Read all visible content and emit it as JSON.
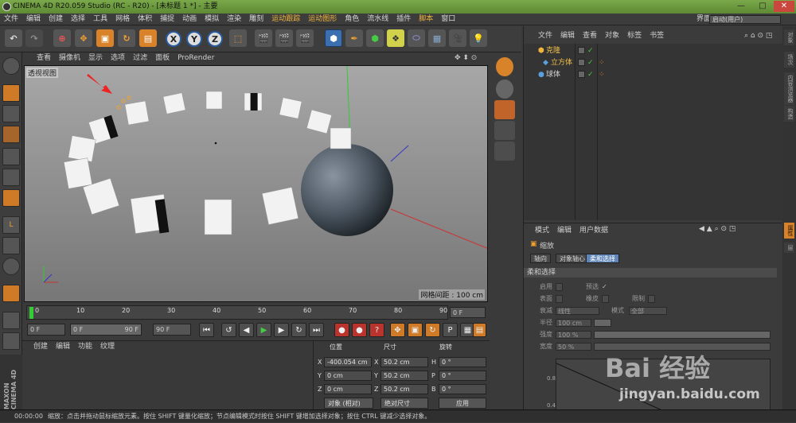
{
  "title": "CINEMA 4D R20.059 Studio (RC - R20) - [未标题 1 *] - 主要",
  "menu": [
    "文件",
    "编辑",
    "创建",
    "选择",
    "工具",
    "网格",
    "体积",
    "捕捉",
    "动画",
    "模拟",
    "渲染",
    "雕刻",
    "运动跟踪",
    "运动图形",
    "角色",
    "流水线",
    "插件",
    "脚本",
    "窗口"
  ],
  "interface": {
    "label": "界面:",
    "value": "启动(用户)"
  },
  "toolbar_axes": [
    "X",
    "Y",
    "Z"
  ],
  "viewport": {
    "menu": [
      "查看",
      "摄像机",
      "显示",
      "选项",
      "过滤",
      "面板",
      "ProRender"
    ],
    "label": "透视视图",
    "grid": "网格间距 : 100 cm"
  },
  "object_manager": {
    "menu": [
      "文件",
      "编辑",
      "查看",
      "对象",
      "标签",
      "书签"
    ],
    "objects": [
      {
        "name": "克隆",
        "indent": 0
      },
      {
        "name": "立方体",
        "indent": 1
      },
      {
        "name": "球体",
        "indent": 0
      }
    ]
  },
  "attributes": {
    "menu": [
      "模式",
      "编辑",
      "用户数据"
    ],
    "object_name": "缩放",
    "tabs": [
      "轴向",
      "对象轴心",
      "柔和选择"
    ],
    "section": "柔和选择",
    "fields": {
      "enable": "启用",
      "preview": "预选",
      "surface": "表面",
      "rubber": "橡皮",
      "limit": "限制",
      "mode_label": "衰减",
      "mode_value": "线性",
      "mode2_label": "模式",
      "mode2_value": "全部",
      "radius_label": "半径",
      "radius_value": "100 cm",
      "strength_label": "强度",
      "strength_value": "100 %",
      "width_label": "宽度",
      "width_value": "50 %"
    },
    "graph_ticks": [
      "0.8",
      "0.4"
    ]
  },
  "side_tabs": [
    "对象",
    "场次",
    "内容浏览器",
    "构造",
    "属性",
    "层"
  ],
  "timeline": {
    "ticks": [
      "0",
      "10",
      "20",
      "30",
      "40",
      "50",
      "60",
      "70",
      "80",
      "90"
    ],
    "current": "0 F"
  },
  "transport": {
    "start": "0 F",
    "range_start": "0 F",
    "range_end": "90 F",
    "end": "90 F"
  },
  "material_manager": {
    "menu": [
      "创建",
      "编辑",
      "功能",
      "纹理"
    ]
  },
  "coordinates": {
    "headers": [
      "位置",
      "尺寸",
      "旋转"
    ],
    "rows": [
      {
        "axis": "X",
        "pos": "-400.054 cm",
        "size_axis": "X",
        "size": "50.2 cm",
        "rot_axis": "H",
        "rot": "0 °"
      },
      {
        "axis": "Y",
        "pos": "0 cm",
        "size_axis": "Y",
        "size": "50.2 cm",
        "rot_axis": "P",
        "rot": "0 °"
      },
      {
        "axis": "Z",
        "pos": "0 cm",
        "size_axis": "Z",
        "size": "50.2 cm",
        "rot_axis": "B",
        "rot": "0 °"
      }
    ],
    "mode": "对象 (相对)",
    "size_mode": "绝对尺寸",
    "apply": "应用"
  },
  "brand": "MAXON CINEMA 4D",
  "status": {
    "time": "00:00:00",
    "message": "缩放：点击并拖动鼠标缩放元素。按住 SHIFT 键量化缩放；节点编辑模式时按住 SHIFT 键增加选择对象；按住 CTRL 键减少选择对象。"
  },
  "watermark": {
    "brand": "Bai 经验",
    "url": "jingyan.baidu.com"
  }
}
